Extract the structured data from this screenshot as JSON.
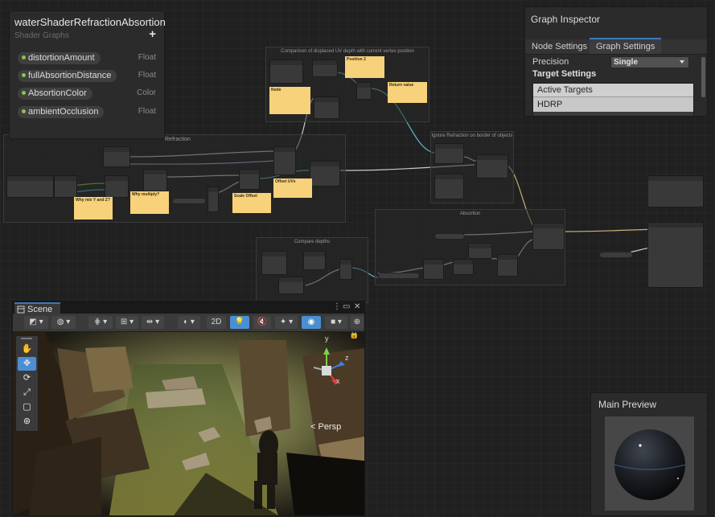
{
  "blackboard": {
    "title": "waterShaderRefractionAbsortion",
    "subtitle": "Shader Graphs",
    "add_label": "+",
    "properties": [
      {
        "name": "distortionAmount",
        "type": "Float"
      },
      {
        "name": "fullAbsortionDistance",
        "type": "Float"
      },
      {
        "name": "AbsortionColor",
        "type": "Color"
      },
      {
        "name": "ambientOcclusion",
        "type": "Float"
      }
    ]
  },
  "graph": {
    "groups": {
      "comparison": "Comparison of displaced UV depth with current vertex position",
      "refraction": "Refraction",
      "ignore": "Ignore Refraction on border of objects",
      "absortion": "Absortion",
      "compare": "Compare depths"
    },
    "notes": {
      "position2": "Position 2",
      "node": "Node",
      "return_value": "Return value",
      "why_mix": "Why mix Y and Z?",
      "why_multiply": "Why multiply?",
      "offset_uvs": "Offset UVs",
      "scale_offset": "Scale Offset"
    }
  },
  "inspector": {
    "title": "Graph Inspector",
    "tabs": [
      "Node Settings",
      "Graph Settings"
    ],
    "active_tab": "Graph Settings",
    "precision_label": "Precision",
    "precision_value": "Single",
    "target_settings_label": "Target Settings",
    "active_targets_label": "Active Targets",
    "targets": [
      "HDRP"
    ]
  },
  "scene": {
    "tab_label": "Scene",
    "toolbar": {
      "mode_2d": "2D"
    },
    "gizmo": {
      "y": "y",
      "z": "z",
      "x": "x"
    },
    "persp_label": "< Persp"
  },
  "preview": {
    "title": "Main Preview"
  },
  "colors": {
    "accent": "#3a79bb",
    "note": "#f7d27a",
    "pill_dot": "#8bc34a"
  }
}
